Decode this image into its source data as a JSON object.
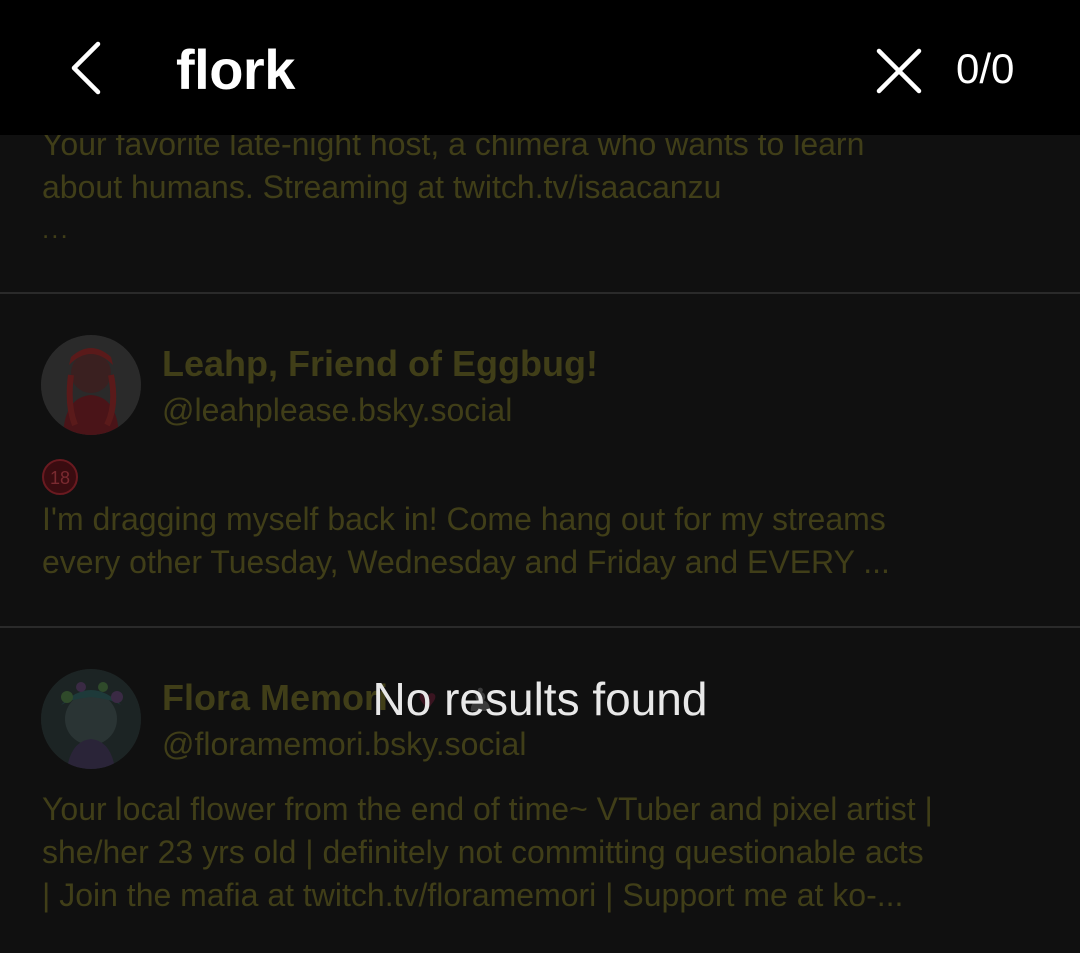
{
  "find_bar": {
    "back_icon": "chevron-left-icon",
    "query": "flork",
    "close_icon": "close-icon",
    "match_count": "0/0"
  },
  "results": {
    "empty_message": "No results found"
  },
  "profiles": [
    {
      "bio_line1": "Your favorite late-night host, a chimera who wants to learn",
      "bio_line2": "about humans. Streaming at twitch.tv/isaacanzu",
      "bio_more": "..."
    },
    {
      "display_name": "Leahp, Friend of Eggbug!",
      "handle": "@leahplease.bsky.social",
      "badge": "18",
      "bio_line1": "I'm dragging myself back in! Come hang out for my streams",
      "bio_line2": "every other Tuesday, Wednesday and Friday and EVERY ..."
    },
    {
      "display_name": "Flora Memori",
      "handle": "@floramemori.bsky.social",
      "bio_line1": "Your local flower from the end of time~ VTuber and pixel artist |",
      "bio_line2": "she/her 23 yrs old | definitely not committing questionable acts",
      "bio_line3": "| Join the mafia at twitch.tv/floramemori | Support me at ko-..."
    }
  ],
  "colors": {
    "find_bar_bg": "#000000",
    "page_bg": "#101010",
    "dimmed_text": "#403e18",
    "divider": "#2a2a2a",
    "message_text": "#e8e8e8"
  }
}
